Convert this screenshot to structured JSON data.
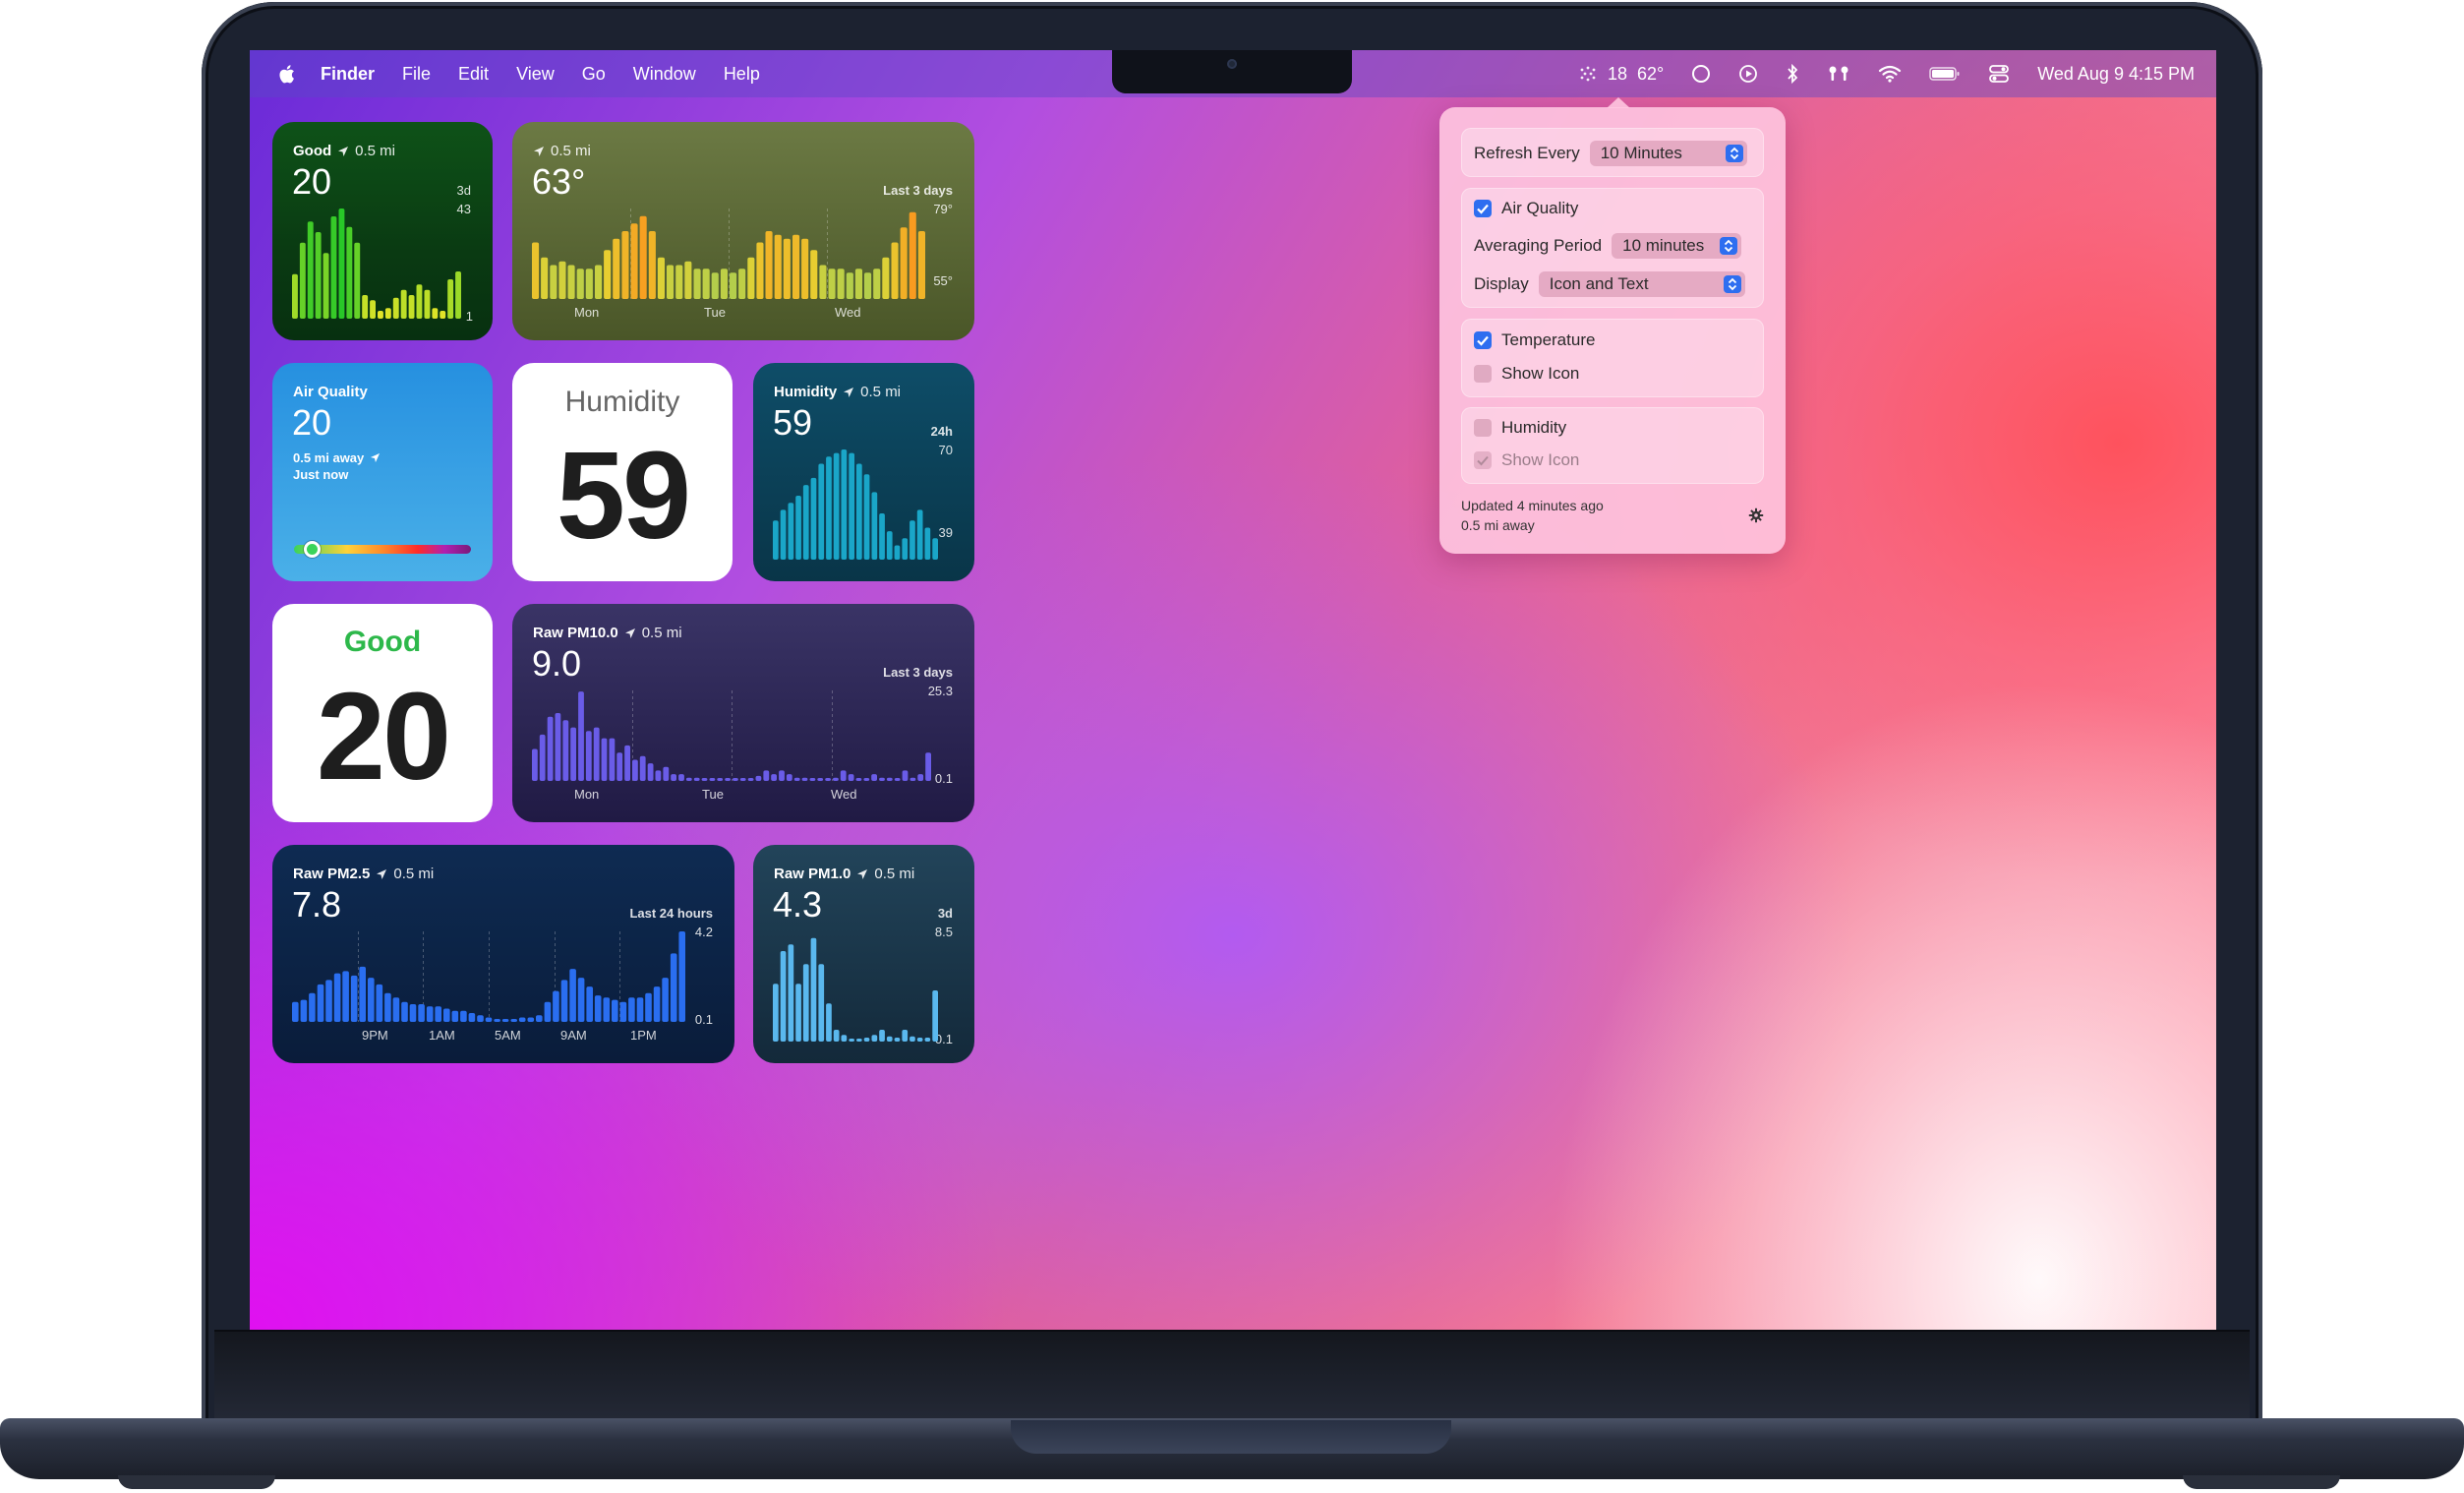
{
  "menubar": {
    "app_name": "Finder",
    "menus": [
      "File",
      "Edit",
      "View",
      "Go",
      "Window",
      "Help"
    ],
    "status_aqi": "18",
    "status_temp": "62°",
    "datetime": "Wed Aug 9  4:15 PM"
  },
  "widgets": {
    "aqi_chart": {
      "title": "Good",
      "distance": "0.5 mi",
      "value": "20",
      "range_label": "3d",
      "max_label": "43",
      "min_label": "1",
      "chart_data": {
        "type": "bar",
        "ylim": [
          1,
          43
        ],
        "values": [
          18,
          30,
          38,
          34,
          26,
          40,
          43,
          36,
          30,
          10,
          8,
          4,
          5,
          9,
          12,
          10,
          14,
          12,
          5,
          4,
          16,
          19
        ]
      }
    },
    "temperature": {
      "distance": "0.5 mi",
      "value": "63°",
      "range_label": "Last 3 days",
      "max_label": "79°",
      "min_label": "55°",
      "x_labels": [
        "Mon",
        "Tue",
        "Wed"
      ],
      "chart_data": {
        "type": "bar",
        "ylim": [
          55,
          79
        ],
        "values": [
          70,
          66,
          64,
          65,
          64,
          63,
          63,
          64,
          68,
          71,
          73,
          75,
          77,
          73,
          66,
          64,
          64,
          65,
          63,
          63,
          62,
          63,
          62,
          63,
          66,
          70,
          73,
          72,
          71,
          72,
          71,
          68,
          64,
          63,
          63,
          62,
          63,
          62,
          63,
          66,
          70,
          74,
          78,
          73
        ]
      }
    },
    "air_quality_card": {
      "title": "Air Quality",
      "value": "20",
      "distance": "0.5 mi away",
      "updated": "Just now",
      "scale_position": 0.1
    },
    "humidity_big": {
      "title": "Humidity",
      "value": "59"
    },
    "humidity_chart": {
      "title": "Humidity",
      "distance": "0.5 mi",
      "value": "59",
      "range_label": "24h",
      "max_label": "70",
      "min_label": "39",
      "chart_data": {
        "type": "bar",
        "ylim": [
          39,
          70
        ],
        "values": [
          50,
          53,
          55,
          57,
          60,
          62,
          66,
          68,
          69,
          70,
          69,
          66,
          63,
          58,
          52,
          47,
          43,
          45,
          50,
          53,
          48,
          45
        ]
      }
    },
    "aqi_big": {
      "title": "Good",
      "value": "20",
      "accent": "#2db84a"
    },
    "pm10": {
      "title": "Raw PM10.0",
      "distance": "0.5 mi",
      "value": "9.0",
      "range_label": "Last 3 days",
      "max_label": "25.3",
      "min_label": "0.1",
      "x_labels": [
        "Mon",
        "Tue",
        "Wed"
      ],
      "chart_data": {
        "type": "bar",
        "ylim": [
          0.1,
          25.3
        ],
        "values": [
          9,
          13,
          18,
          19,
          17,
          15,
          25,
          14,
          15,
          12,
          12,
          8,
          10,
          6,
          7,
          5,
          3,
          4,
          2,
          2,
          1,
          1,
          0.5,
          0.5,
          0.3,
          0.5,
          0.5,
          0.8,
          0.8,
          1.5,
          3,
          2,
          3,
          2,
          1,
          1,
          0.5,
          0.5,
          0.5,
          1,
          3,
          2,
          0.8,
          0.8,
          2,
          1,
          1,
          0.8,
          3,
          1,
          2,
          8
        ]
      }
    },
    "pm25": {
      "title": "Raw PM2.5",
      "distance": "0.5 mi",
      "value": "7.8",
      "range_label": "Last 24 hours",
      "max_label": "4.2",
      "min_label": "0.1",
      "x_labels": [
        "9PM",
        "1AM",
        "5AM",
        "9AM",
        "1PM"
      ],
      "chart_data": {
        "type": "bar",
        "ylim": [
          0.1,
          4.2
        ],
        "values": [
          1.0,
          1.1,
          1.4,
          1.8,
          2.0,
          2.3,
          2.4,
          2.2,
          2.6,
          2.1,
          1.8,
          1.4,
          1.2,
          1.0,
          0.9,
          0.9,
          0.8,
          0.8,
          0.7,
          0.6,
          0.6,
          0.5,
          0.4,
          0.3,
          0.2,
          0.2,
          0.2,
          0.3,
          0.3,
          0.4,
          1.0,
          1.5,
          2.0,
          2.5,
          2.1,
          1.7,
          1.3,
          1.2,
          1.1,
          1.0,
          1.2,
          1.2,
          1.4,
          1.7,
          2.1,
          3.2,
          4.2
        ]
      }
    },
    "pm1": {
      "title": "Raw PM1.0",
      "distance": "0.5 mi",
      "value": "4.3",
      "range_label": "3d",
      "max_label": "8.5",
      "min_label": "0.1",
      "chart_data": {
        "type": "bar",
        "ylim": [
          0.1,
          8.5
        ],
        "values": [
          4.5,
          7.0,
          7.5,
          4.5,
          6.0,
          8.0,
          6.0,
          3.0,
          1.0,
          0.6,
          0.3,
          0.3,
          0.4,
          0.6,
          1.0,
          0.5,
          0.4,
          1.0,
          0.5,
          0.4,
          0.4,
          4.0
        ]
      }
    }
  },
  "popover": {
    "refresh_label": "Refresh Every",
    "refresh_value": "10 Minutes",
    "aq_label": "Air Quality",
    "averaging_label": "Averaging Period",
    "averaging_value": "10 minutes",
    "display_label": "Display",
    "display_value": "Icon and Text",
    "temperature_label": "Temperature",
    "temp_show_icon": "Show Icon",
    "humidity_label": "Humidity",
    "humidity_show_icon": "Show Icon",
    "updated": "Updated 4 minutes ago",
    "distance": "0.5 mi away"
  }
}
